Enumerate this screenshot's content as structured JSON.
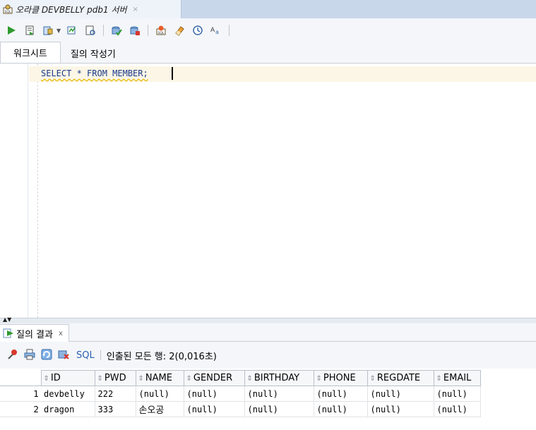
{
  "document_tab": {
    "title": "오라클 DEVBELLY pdb1 서버",
    "close_glyph": "×"
  },
  "toolbar": {
    "buttons": [
      {
        "name": "run-statement",
        "icon": "run-icon"
      },
      {
        "name": "run-script",
        "icon": "script-icon"
      },
      {
        "name": "commit",
        "icon": "commit-icon"
      },
      {
        "name": "autotrace",
        "icon": "autotrace-icon"
      },
      {
        "name": "explain-plan",
        "icon": "explain-icon"
      },
      {
        "name": "sql-tuning",
        "icon": "tuning-icon"
      },
      {
        "name": "rollback",
        "icon": "rollback-icon"
      },
      {
        "name": "unshared-sql",
        "icon": "unshared-sql-icon"
      },
      {
        "name": "clear",
        "icon": "eraser-icon"
      },
      {
        "name": "history",
        "icon": "history-icon"
      },
      {
        "name": "format",
        "icon": "format-icon"
      }
    ]
  },
  "worksheet_tabs": [
    {
      "label": "워크시트",
      "active": true
    },
    {
      "label": "질의 작성기",
      "active": false
    }
  ],
  "editor": {
    "code": "SELECT * FROM MEMBER;"
  },
  "result_panel": {
    "tab_label": "질의 결과",
    "tab_close": "x",
    "sql_label": "SQL",
    "status": "인출된 모든 행: 2(0,016초)"
  },
  "grid": {
    "columns": [
      "ID",
      "PWD",
      "NAME",
      "GENDER",
      "BIRTHDAY",
      "PHONE",
      "REGDATE",
      "EMAIL"
    ],
    "rows": [
      {
        "num": "1",
        "cells": [
          "devbelly",
          "222",
          "(null)",
          "(null)",
          "(null)",
          "(null)",
          "(null)",
          "(null)"
        ]
      },
      {
        "num": "2",
        "cells": [
          "dragon",
          "333",
          "손오공",
          "(null)",
          "(null)",
          "(null)",
          "(null)",
          "(null)"
        ]
      }
    ]
  },
  "colors": {
    "tab_bar": "#c9d7ea",
    "toolbar_bg": "#f4f6f9",
    "current_line": "#fbf6e6",
    "keyword_text": "#1a3a8a",
    "link_blue": "#2a5fb0"
  }
}
